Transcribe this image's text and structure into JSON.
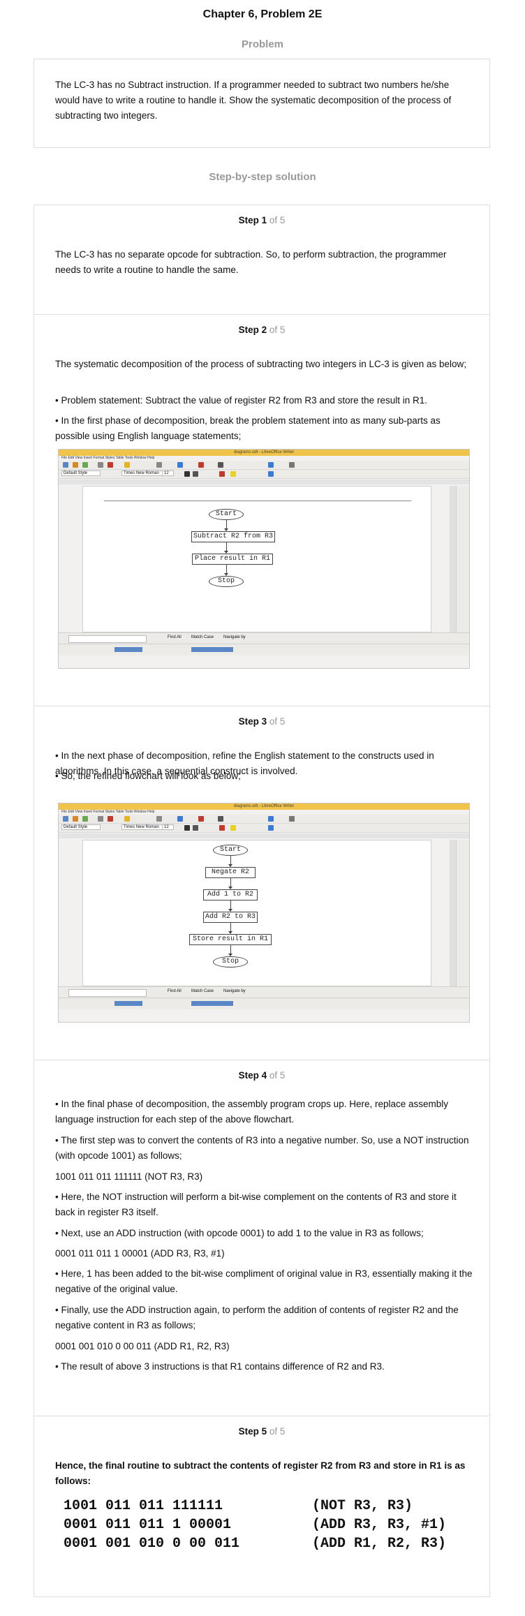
{
  "title": "Chapter 6, Problem 2E",
  "problem_heading": "Problem",
  "problem_text": "The LC-3 has no Subtract instruction. If a programmer needed to subtract two numbers he/she would have to write a routine to handle it. Show the systematic decomposition of the process of subtracting two integers.",
  "solution_heading": "Step-by-step solution",
  "step_word": "Step",
  "of_total": "of 5",
  "steps": [
    {
      "num": "1",
      "paras": [
        "The LC-3 has no separate opcode for subtraction. So, to perform subtraction, the programmer needs to write a routine to handle the same."
      ]
    },
    {
      "num": "2",
      "paras": [
        "The systematic decomposition of the process of subtracting two integers in LC-3 is given as below;",
        "• Problem statement: Subtract the value of register R2 from R3 and store the result in R1.",
        "• In the first phase of decomposition, break the problem statement into as many sub-parts as possible using English language statements;"
      ]
    },
    {
      "num": "3",
      "paras": [
        "• In the next phase of decomposition, refine the English statement to the constructs used in algorithms. In this case, a sequential construct is involved.",
        "• So, the refined flowchart will look as below;"
      ]
    },
    {
      "num": "4",
      "paras": [
        "• In the final phase of decomposition, the assembly program crops up. Here, replace assembly language instruction for each step of the above flowchart.",
        "• The first step was to convert the contents of R3 into a negative number. So, use a NOT instruction (with opcode 1001) as follows;",
        "1001 011 011 111111 (NOT R3, R3)",
        "• Here, the NOT instruction will perform a bit-wise complement on the contents of R3 and store it back in register R3 itself.",
        "• Next, use an ADD instruction (with opcode 0001) to add 1 to the value in R3 as follows;",
        "0001 011 011 1 00001 (ADD R3, R3, #1)",
        "• Here, 1 has been added to the bit-wise compliment of original value in R3, essentially making it the negative of the original value.",
        "• Finally, use the ADD instruction again, to perform the addition of contents of register R2 and the negative content in R3 as follows;",
        "0001 001 010 0 00 011 (ADD R1, R2, R3)",
        "• The result of above 3 instructions is that R1 contains difference of R2 and R3."
      ]
    },
    {
      "num": "5",
      "intro": "Hence, the final routine to subtract the contents of register R2 from R3 and store in R1 is as follows:",
      "code": [
        {
          "bin": "1001 011 011 111111",
          "asm": "(NOT R3, R3)"
        },
        {
          "bin": "0001 011 011 1 00001",
          "asm": "(ADD R3, R3, #1)"
        },
        {
          "bin": "0001 001 010 0 00 011",
          "asm": "(ADD R1, R2, R3)"
        }
      ]
    }
  ],
  "screenshot": {
    "window_title": "diagrams.odt - LibreOffice Writer",
    "menu": "File  Edit  View  Insert  Format  Styles  Table  Tools  Window  Help",
    "style_box": "Default Style",
    "font_box": "Times New Roman",
    "size_box": "12",
    "find_label": "Find All",
    "match_case": "Match Case",
    "navigate": "Navigate by"
  },
  "flow1": [
    "Start",
    "Subtract R2 from R3",
    "Place result in R1",
    "Stop"
  ],
  "flow2": [
    "Start",
    "Negate R2",
    "Add 1 to R2",
    "Add R2 to R3",
    "Store result in R1",
    "Stop"
  ]
}
